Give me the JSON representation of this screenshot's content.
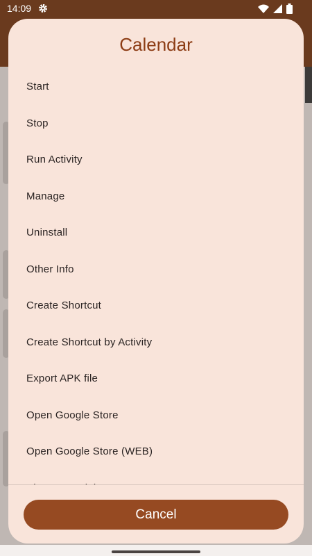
{
  "status_bar": {
    "time": "14:09"
  },
  "dialog": {
    "title": "Calendar",
    "items": [
      {
        "label": "Start"
      },
      {
        "label": "Stop"
      },
      {
        "label": "Run Activity"
      },
      {
        "label": "Manage"
      },
      {
        "label": "Uninstall"
      },
      {
        "label": "Other Info"
      },
      {
        "label": "Create Shortcut"
      },
      {
        "label": "Create Shortcut by Activity"
      },
      {
        "label": "Export APK file"
      },
      {
        "label": "Open Google Store"
      },
      {
        "label": "Open Google Store (WEB)"
      },
      {
        "label": "Share App Link"
      }
    ],
    "cancel_label": "Cancel"
  },
  "colors": {
    "accent": "#964a22",
    "status_bar": "#6a3a1e",
    "dialog_bg": "#f9e4da",
    "title": "#8c3c14"
  },
  "icons": [
    "gear-icon",
    "wifi-icon",
    "signal-icon",
    "battery-icon"
  ]
}
